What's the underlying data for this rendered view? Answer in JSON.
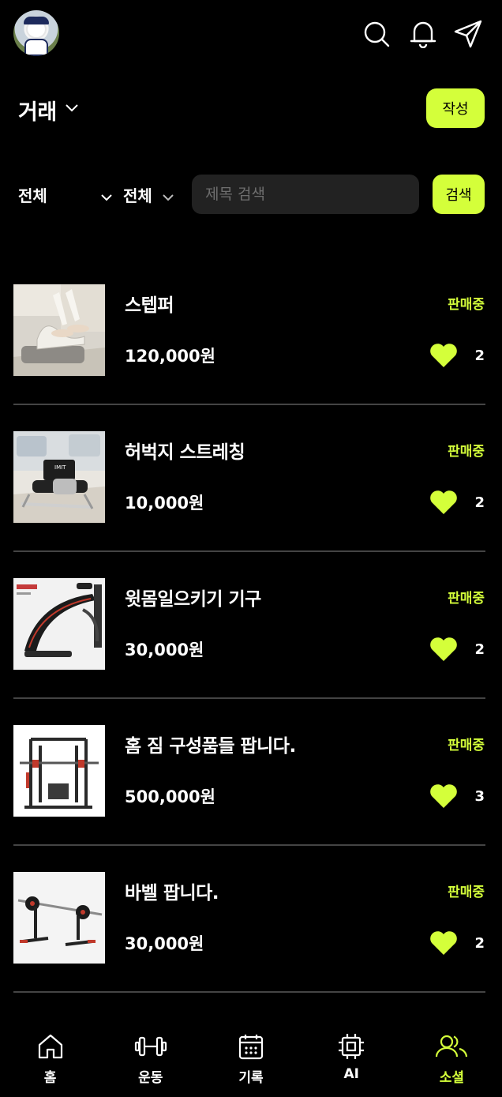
{
  "header": {
    "icons": [
      "search-icon",
      "bell-icon",
      "send-icon"
    ]
  },
  "section": {
    "title": "거래",
    "write_label": "작성"
  },
  "filters": {
    "category": "전체",
    "status": "전체",
    "search_placeholder": "제목 검색",
    "search_label": "검색"
  },
  "items": [
    {
      "title": "스텝퍼",
      "price": "120,000원",
      "status": "판매중",
      "likes": "2"
    },
    {
      "title": "허벅지 스트레칭",
      "price": "10,000원",
      "status": "판매중",
      "likes": "2"
    },
    {
      "title": "윗몸일으키기 기구",
      "price": "30,000원",
      "status": "판매중",
      "likes": "2"
    },
    {
      "title": "홈 짐 구성품들 팝니다.",
      "price": "500,000원",
      "status": "판매중",
      "likes": "3"
    },
    {
      "title": "바벨 팝니다.",
      "price": "30,000원",
      "status": "판매중",
      "likes": "2"
    }
  ],
  "nav": [
    {
      "label": "홈",
      "icon": "home-icon"
    },
    {
      "label": "운동",
      "icon": "dumbbell-icon"
    },
    {
      "label": "기록",
      "icon": "calendar-icon"
    },
    {
      "label": "AI",
      "icon": "chip-icon"
    },
    {
      "label": "소셜",
      "icon": "users-icon",
      "active": true
    }
  ],
  "colors": {
    "accent": "#d4ff3a",
    "background": "#000000",
    "field": "#222222"
  }
}
